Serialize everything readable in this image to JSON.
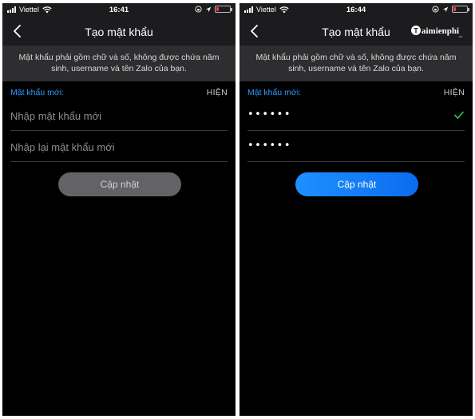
{
  "left": {
    "status_bar": {
      "carrier": "Viettel",
      "time": "16:41"
    },
    "nav": {
      "title": "Tạo mật khẩu"
    },
    "notice": "Mật khẩu phải gồm chữ và số, không được chứa năm sinh, username và tên Zalo của bạn.",
    "form": {
      "label": "Mật khẩu mới:",
      "show_toggle": "HIỆN",
      "new_password_placeholder": "Nhập mật khẩu mới",
      "confirm_password_placeholder": "Nhập lại mật khẩu mới",
      "update_button": "Cập nhật"
    }
  },
  "right": {
    "status_bar": {
      "carrier": "Viettel",
      "time": "16:44"
    },
    "nav": {
      "title": "Tạo mật khẩu"
    },
    "watermark": "Taimienphi",
    "notice": "Mật khẩu phải gồm chữ và số, không được chứa năm sinh, username và tên Zalo của bạn.",
    "form": {
      "label": "Mật khẩu mới:",
      "show_toggle": "HIỆN",
      "new_password_value": "••••••",
      "confirm_password_value": "••••••",
      "update_button": "Cập nhật"
    }
  },
  "colors": {
    "accent": "#2f9bff",
    "button_disabled": "#636366",
    "button_active": "#1e90ff",
    "check": "#34c759",
    "battery": "#ff3b30"
  },
  "icons": [
    "back-arrow-icon",
    "wifi-icon",
    "location-icon",
    "battery-icon",
    "signal-icon",
    "lock-rotation-icon",
    "checkmark-icon"
  ],
  "battery_level": 0.15
}
